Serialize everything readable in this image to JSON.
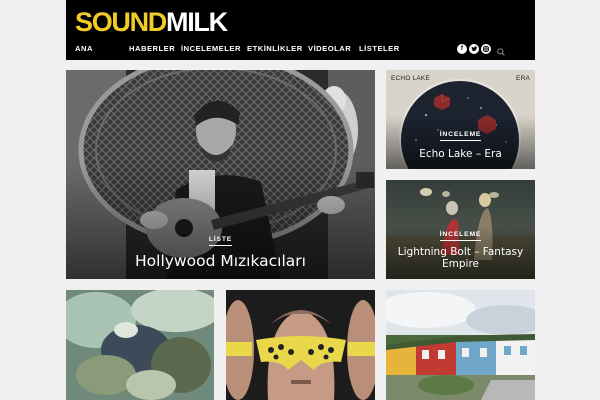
{
  "site": {
    "logo_part1": "SOUND",
    "logo_part2": "MILK"
  },
  "nav": {
    "items": [
      "ANA",
      "HABERLER",
      "İNCELEMELER",
      "ETKİNLİKLER",
      "VİDEOLAR",
      "LİSTELER"
    ],
    "social_icons": [
      "facebook-icon",
      "twitter-icon",
      "instagram-icon"
    ],
    "search_icon": "search-icon"
  },
  "colors": {
    "header_bg": "#000000",
    "logo_accent": "#f1cc25",
    "page_bg": "#f0f0f0"
  },
  "cards": [
    {
      "category": "LİSTE",
      "title": "Hollywood Mızıkacıları"
    },
    {
      "category": "İNCELEME",
      "title": "Echo Lake – Era",
      "cover_left": "ECHO LAKE",
      "cover_right": "ERA"
    },
    {
      "category": "İNCELEME",
      "title": "Lightning Bolt – Fantasy Empire"
    },
    {
      "category": "",
      "title": ""
    },
    {
      "category": "",
      "title": ""
    },
    {
      "category": "",
      "title": ""
    }
  ]
}
